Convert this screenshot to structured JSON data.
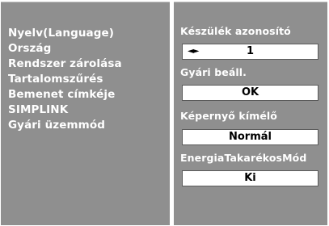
{
  "menu": {
    "items": [
      {
        "label": "Nyelv(Language)"
      },
      {
        "label": "Ország"
      },
      {
        "label": "Rendszer zárolása"
      },
      {
        "label": "Tartalomszűrés"
      },
      {
        "label": "Bemenet címkéje"
      },
      {
        "label": "SIMPLINK"
      },
      {
        "label": "Gyári üzemmód"
      }
    ],
    "selected": "Gyári üzemmód"
  },
  "settings": {
    "device_id": {
      "label": "Készülék azonosító",
      "value": "1",
      "arrows": "◄►"
    },
    "factory_reset": {
      "label": "Gyári beáll.",
      "value": "OK"
    },
    "screensaver": {
      "label": "Képernyő kímélő",
      "value": "Normál"
    },
    "energy_saving": {
      "label": "EnergiaTakarékosMód",
      "value": "Ki"
    }
  },
  "colors": {
    "panel_background": "#8f8f8f",
    "text": "#ffffff",
    "value_box": "#ffffff"
  }
}
